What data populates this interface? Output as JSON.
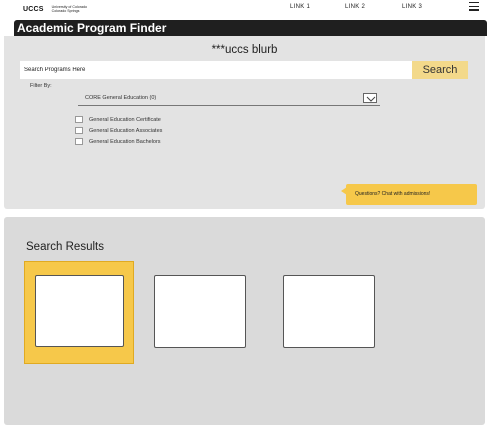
{
  "header": {
    "logo": "UCCS",
    "logo_line1": "University of Colorado",
    "logo_line2": "Colorado Springs",
    "links": [
      "LINK 1",
      "LINK 2",
      "LINK 3"
    ],
    "menu_icon": "hamburger-menu-icon"
  },
  "finder": {
    "title": "Academic Program Finder",
    "blurb": "***uccs blurb",
    "search_placeholder": "Search Programs Here",
    "search_button": "Search",
    "filter_label": "Filter By:",
    "dropdown_value": "CORE General Education (0)",
    "dropdown_icon": "chevron-down-icon",
    "checkboxes": [
      "General Education Certificate",
      "General Education Associates",
      "General Education Bachelors"
    ],
    "chat_button": "Questions? Chat with admissions!"
  },
  "results": {
    "heading": "Search Results",
    "cards_count": 3,
    "selected_index": 0
  },
  "colors": {
    "accent_yellow": "#f6c84a",
    "search_button_bg": "#f3d98a",
    "title_bar_bg": "#1f1f1f",
    "panel_bg": "#e3e3e3"
  }
}
